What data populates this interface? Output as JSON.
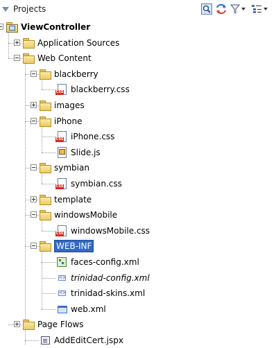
{
  "header": {
    "title": "Projects",
    "icons": [
      "find-icon",
      "sync-icon",
      "filter-icon",
      "layout-icon"
    ]
  },
  "tree": [
    {
      "label": "ViewController",
      "type": "project",
      "expanded": true
    },
    {
      "label": "Application Sources",
      "type": "folder",
      "expanded": false
    },
    {
      "label": "Web Content",
      "type": "folder",
      "expanded": true
    },
    {
      "label": "blackberry",
      "type": "folder",
      "expanded": true
    },
    {
      "label": "blackberry.css",
      "type": "css"
    },
    {
      "label": "images",
      "type": "folder",
      "expanded": false
    },
    {
      "label": "iPhone",
      "type": "folder",
      "expanded": true
    },
    {
      "label": "iPhone.css",
      "type": "css"
    },
    {
      "label": "Slide.js",
      "type": "js"
    },
    {
      "label": "symbian",
      "type": "folder",
      "expanded": true
    },
    {
      "label": "symbian.css",
      "type": "css"
    },
    {
      "label": "template",
      "type": "folder",
      "expanded": false
    },
    {
      "label": "windowsMobile",
      "type": "folder",
      "expanded": true
    },
    {
      "label": "windowsMobile.css",
      "type": "css"
    },
    {
      "label": "WEB-INF",
      "type": "folder",
      "expanded": true,
      "selected": true
    },
    {
      "label": "faces-config.xml",
      "type": "faces"
    },
    {
      "label": "trinidad-config.xml",
      "type": "xml",
      "italic": true
    },
    {
      "label": "trinidad-skins.xml",
      "type": "xml"
    },
    {
      "label": "web.xml",
      "type": "web"
    },
    {
      "label": "Page Flows",
      "type": "folder",
      "expanded": false
    },
    {
      "label": "AddEditCert.jspx",
      "type": "jspx"
    }
  ]
}
